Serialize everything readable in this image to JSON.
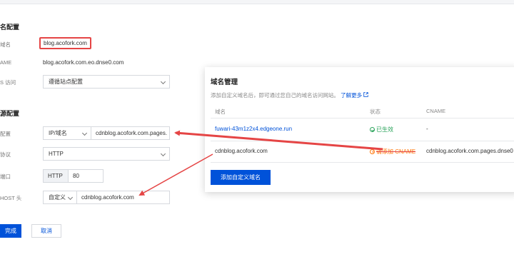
{
  "domain_section": {
    "title": "名配置",
    "domain_label": "域名",
    "domain_value": "blog.acofork.com",
    "cname_label": "AME",
    "cname_value": "blog.acofork.com.eo.dnse0.com",
    "https_label": "S 访问",
    "https_select": "遵循站点配置"
  },
  "origin_section": {
    "title": "源配置",
    "origin_label": "配置",
    "origin_type": "IP/域名",
    "origin_value": "cdnblog.acofork.com.pages.",
    "protocol_label": "协议",
    "protocol_value": "HTTP",
    "port_label": "端口",
    "port_prefix": "HTTP",
    "port_value": "80",
    "host_label": "HOST 头",
    "host_mode": "自定义",
    "host_value": "cdnblog.acofork.com"
  },
  "footer": {
    "confirm_label": "完成",
    "cancel_label": "取消"
  },
  "panel": {
    "title": "域名管理",
    "desc": "添加自定义域名后，即可通过您自己的域名访问网站。",
    "learn_more": "了解更多",
    "columns": [
      "域名",
      "状态",
      "CNAME"
    ],
    "rows": [
      {
        "domain": "fuwari-43m1z2x4.edgeone.run",
        "status": "已生效",
        "cname": "-"
      },
      {
        "domain": "cdnblog.acofork.com",
        "status": "请添加 CNAME",
        "cname": "cdnblog.acofork.com.pages.dnse0"
      }
    ],
    "add_button": "添加自定义域名"
  },
  "colors": {
    "primary": "#0052d9",
    "highlight": "#e54545",
    "success": "#29a35a",
    "warning": "#ff7200"
  }
}
